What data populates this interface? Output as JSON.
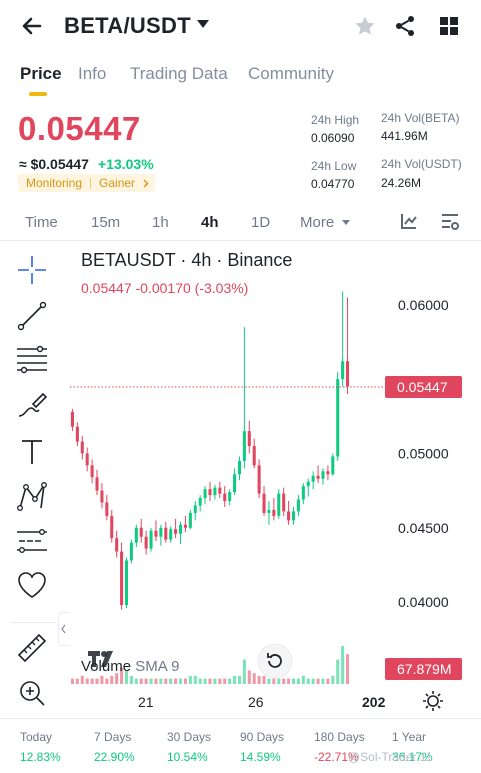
{
  "header": {
    "pair": "BETA/USDT"
  },
  "tabs": [
    "Price",
    "Info",
    "Trading Data",
    "Community"
  ],
  "price": {
    "last": "0.05447",
    "fiat": "≈ $0.05447",
    "change": "+13.03%",
    "tags": [
      "Monitoring",
      "Gainer"
    ]
  },
  "stats": {
    "high_label": "24h High",
    "high_value": "0.06090",
    "low_label": "24h Low",
    "low_value": "0.04770",
    "volb_label": "24h Vol(BETA)",
    "volb_value": "441.96M",
    "volu_label": "24h Vol(USDT)",
    "volu_value": "24.26M"
  },
  "intervals": [
    "Time",
    "15m",
    "1h",
    "4h",
    "1D",
    "More"
  ],
  "chart": {
    "title": "BETAUSDT · 4h · Binance",
    "subtitle": "0.05447  -0.00170 (-3.03%)",
    "price_ticks": [
      "0.06000",
      "0.05000",
      "0.04500",
      "0.04000"
    ],
    "price_tag": "0.05447",
    "volume_label": "Volume",
    "volume_sma": "SMA 9",
    "volume_tag": "67.879M",
    "time_ticks": [
      "21",
      "26",
      "202"
    ],
    "colors": {
      "up": "#0ecb81",
      "down": "#e0465e",
      "accent": "#f0b90b"
    }
  },
  "chart_data": {
    "type": "candlestick",
    "title": "BETAUSDT · 4h · Binance",
    "ylim": [
      0.0392,
      0.0614
    ],
    "y_ticks": [
      0.06,
      0.05,
      0.045,
      0.04
    ],
    "x_ticks": [
      "21",
      "26",
      "202"
    ],
    "last_price": 0.05447,
    "ohlc": [
      [
        0.0528,
        0.053,
        0.0515,
        0.0518
      ],
      [
        0.0518,
        0.0521,
        0.0505,
        0.0508
      ],
      [
        0.0508,
        0.0512,
        0.0496,
        0.05
      ],
      [
        0.05,
        0.0504,
        0.0488,
        0.0492
      ],
      [
        0.0492,
        0.0496,
        0.048,
        0.0484
      ],
      [
        0.0484,
        0.0489,
        0.0472,
        0.0475
      ],
      [
        0.0475,
        0.048,
        0.0463,
        0.0467
      ],
      [
        0.0467,
        0.0472,
        0.0455,
        0.0458
      ],
      [
        0.0458,
        0.0462,
        0.044,
        0.0443
      ],
      [
        0.0443,
        0.0448,
        0.043,
        0.0434
      ],
      [
        0.0434,
        0.044,
        0.0395,
        0.0398
      ],
      [
        0.0398,
        0.043,
        0.0396,
        0.0428
      ],
      [
        0.0428,
        0.0442,
        0.0426,
        0.044
      ],
      [
        0.044,
        0.0452,
        0.0437,
        0.045
      ],
      [
        0.045,
        0.0456,
        0.044,
        0.0444
      ],
      [
        0.0444,
        0.0448,
        0.0432,
        0.0436
      ],
      [
        0.0436,
        0.045,
        0.0434,
        0.0448
      ],
      [
        0.0448,
        0.0455,
        0.0441,
        0.0444
      ],
      [
        0.0444,
        0.0452,
        0.0438,
        0.045
      ],
      [
        0.045,
        0.0454,
        0.044,
        0.0442
      ],
      [
        0.0442,
        0.0451,
        0.044,
        0.0449
      ],
      [
        0.0449,
        0.0456,
        0.0443,
        0.0446
      ],
      [
        0.0446,
        0.0454,
        0.0439,
        0.0452
      ],
      [
        0.0452,
        0.0458,
        0.0447,
        0.045
      ],
      [
        0.045,
        0.0462,
        0.0449,
        0.046
      ],
      [
        0.046,
        0.0468,
        0.0455,
        0.0465
      ],
      [
        0.0465,
        0.0472,
        0.0461,
        0.047
      ],
      [
        0.047,
        0.0478,
        0.0466,
        0.0476
      ],
      [
        0.0476,
        0.0481,
        0.0468,
        0.0472
      ],
      [
        0.0472,
        0.0479,
        0.0469,
        0.0477
      ],
      [
        0.0477,
        0.0481,
        0.047,
        0.0473
      ],
      [
        0.0473,
        0.0478,
        0.0464,
        0.0468
      ],
      [
        0.0468,
        0.0476,
        0.0465,
        0.0474
      ],
      [
        0.0474,
        0.049,
        0.0472,
        0.0486
      ],
      [
        0.0486,
        0.0498,
        0.0482,
        0.0495
      ],
      [
        0.0495,
        0.0585,
        0.049,
        0.0515
      ],
      [
        0.0515,
        0.0522,
        0.05,
        0.0505
      ],
      [
        0.0505,
        0.051,
        0.049,
        0.0492
      ],
      [
        0.0492,
        0.0496,
        0.047,
        0.0473
      ],
      [
        0.0473,
        0.0478,
        0.0458,
        0.046
      ],
      [
        0.046,
        0.0468,
        0.0452,
        0.0462
      ],
      [
        0.0462,
        0.047,
        0.0455,
        0.0458
      ],
      [
        0.0458,
        0.0476,
        0.0456,
        0.0473
      ],
      [
        0.0473,
        0.0477,
        0.0458,
        0.0461
      ],
      [
        0.0461,
        0.0468,
        0.0452,
        0.0455
      ],
      [
        0.0455,
        0.0464,
        0.0452,
        0.0461
      ],
      [
        0.0461,
        0.0472,
        0.0458,
        0.0469
      ],
      [
        0.0469,
        0.048,
        0.0466,
        0.0478
      ],
      [
        0.0478,
        0.0483,
        0.0471,
        0.0481
      ],
      [
        0.0481,
        0.0488,
        0.0476,
        0.0485
      ],
      [
        0.0485,
        0.0492,
        0.048,
        0.0483
      ],
      [
        0.0483,
        0.049,
        0.0479,
        0.0488
      ],
      [
        0.0488,
        0.0492,
        0.0482,
        0.0486
      ],
      [
        0.0486,
        0.05,
        0.0485,
        0.0498
      ],
      [
        0.0498,
        0.0555,
        0.0495,
        0.055
      ],
      [
        0.055,
        0.0609,
        0.0545,
        0.0562
      ],
      [
        0.0562,
        0.0605,
        0.054,
        0.0545
      ]
    ],
    "volume": [
      2,
      2,
      3,
      2,
      2,
      2,
      3,
      2,
      3,
      4,
      6,
      5,
      3,
      2,
      2,
      2,
      2,
      2,
      2,
      2,
      2,
      2,
      2,
      2,
      3,
      3,
      2,
      2,
      2,
      2,
      2,
      2,
      2,
      3,
      3,
      9,
      5,
      4,
      3,
      3,
      2,
      2,
      2,
      2,
      2,
      2,
      2,
      3,
      2,
      2,
      2,
      2,
      2,
      3,
      9,
      14,
      11
    ]
  },
  "bottom": {
    "labels": [
      "Today",
      "7 Days",
      "30 Days",
      "90 Days",
      "180 Days",
      "1 Year"
    ],
    "values": [
      "12.83%",
      "22.90%",
      "10.54%",
      "14.59%",
      "-22.71%",
      "36.17%"
    ],
    "watermark": "@Sol-Trader 11"
  }
}
